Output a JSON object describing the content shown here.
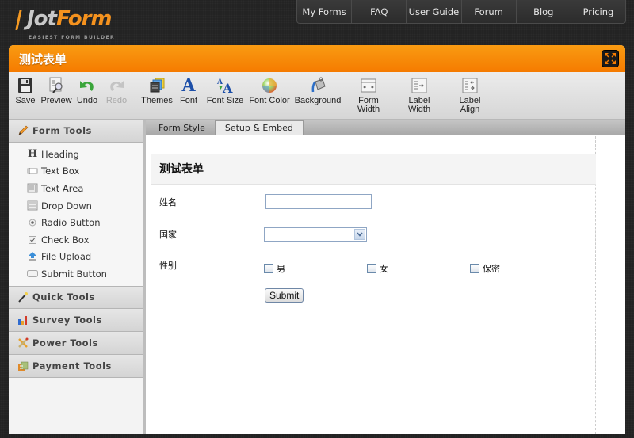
{
  "logo": {
    "brand_part1": "Jot",
    "brand_part2": "Form",
    "tagline": "EASIEST FORM BUILDER"
  },
  "topnav": {
    "items": [
      {
        "label": "My Forms"
      },
      {
        "label": "FAQ"
      },
      {
        "label": "User Guide"
      },
      {
        "label": "Forum"
      },
      {
        "label": "Blog"
      },
      {
        "label": "Pricing"
      }
    ]
  },
  "window": {
    "title": "测试表单",
    "maximize_icon": "expand-arrows-icon"
  },
  "toolbar": {
    "buttons": [
      {
        "label": "Save",
        "icon": "floppy-disk-icon",
        "enabled": true
      },
      {
        "label": "Preview",
        "icon": "preview-magnifier-icon",
        "enabled": true
      },
      {
        "label": "Undo",
        "icon": "undo-arrow-icon",
        "enabled": true
      },
      {
        "label": "Redo",
        "icon": "redo-arrow-icon",
        "enabled": false
      },
      {
        "label": "Themes",
        "icon": "themes-stack-icon",
        "enabled": true
      },
      {
        "label": "Font",
        "icon": "font-letter-icon",
        "enabled": true
      },
      {
        "label": "Font Size",
        "icon": "font-size-icon",
        "enabled": true
      },
      {
        "label": "Font Color",
        "icon": "color-wheel-icon",
        "enabled": true
      },
      {
        "label": "Background",
        "icon": "paint-bucket-icon",
        "enabled": true
      },
      {
        "label": "Form\nWidth",
        "icon": "form-width-icon",
        "enabled": true
      },
      {
        "label": "Label\nWidth",
        "icon": "label-width-icon",
        "enabled": true
      },
      {
        "label": "Label\nAlign",
        "icon": "label-align-icon",
        "enabled": true
      }
    ]
  },
  "sidebar": {
    "form_tools": {
      "label": "Form Tools",
      "icon": "pencil-icon",
      "items": [
        {
          "label": "Heading",
          "icon": "heading-icon"
        },
        {
          "label": "Text Box",
          "icon": "textbox-icon"
        },
        {
          "label": "Text Area",
          "icon": "textarea-icon"
        },
        {
          "label": "Drop Down",
          "icon": "dropdown-icon"
        },
        {
          "label": "Radio Button",
          "icon": "radio-icon"
        },
        {
          "label": "Check Box",
          "icon": "checkbox-icon"
        },
        {
          "label": "File Upload",
          "icon": "upload-icon"
        },
        {
          "label": "Submit Button",
          "icon": "submit-button-icon"
        }
      ]
    },
    "sections": [
      {
        "label": "Quick Tools",
        "icon": "magic-wand-icon"
      },
      {
        "label": "Survey Tools",
        "icon": "bar-chart-icon"
      },
      {
        "label": "Power Tools",
        "icon": "tools-cross-icon"
      },
      {
        "label": "Payment Tools",
        "icon": "payment-icon"
      }
    ]
  },
  "tabs": [
    {
      "label": "Form Style",
      "active": false
    },
    {
      "label": "Setup & Embed",
      "active": true
    }
  ],
  "form": {
    "heading": "测试表单",
    "fields": {
      "name_label": "姓名",
      "name_value": "",
      "country_label": "国家",
      "country_selected": "",
      "gender_label": "性别",
      "gender_options": [
        "男",
        "女",
        "保密"
      ]
    },
    "submit_label": "Submit"
  }
}
